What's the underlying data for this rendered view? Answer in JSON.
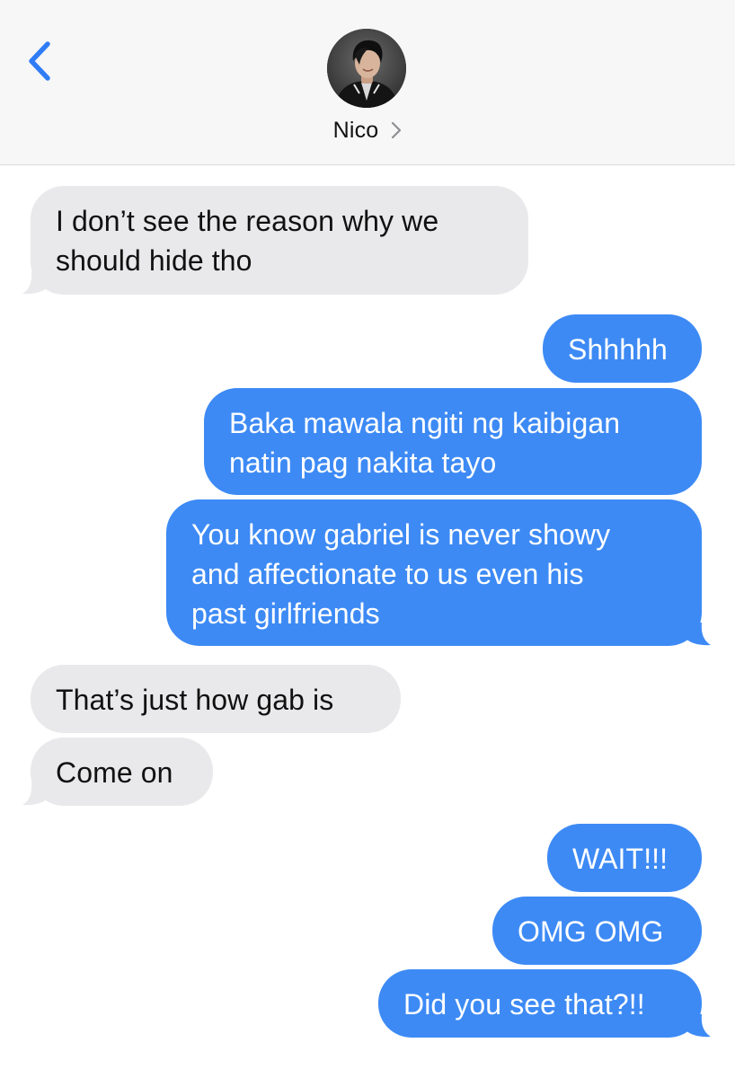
{
  "header": {
    "contact_name": "Nico",
    "back_icon": "chevron-left-icon",
    "details_icon": "chevron-right-icon",
    "avatar_icon": "contact-photo"
  },
  "colors": {
    "sent_bubble": "#3d8af5",
    "received_bubble": "#e9e9eb",
    "accent": "#2f7cf6"
  },
  "messages": [
    {
      "direction": "received",
      "lines": [
        "I don’t see the reason why we",
        "should hide tho"
      ]
    },
    {
      "direction": "sent",
      "lines": [
        "Shhhhh"
      ]
    },
    {
      "direction": "sent",
      "lines": [
        "Baka mawala ngiti ng kaibigan",
        "natin pag nakita tayo"
      ]
    },
    {
      "direction": "sent",
      "lines": [
        "You know gabriel is never showy",
        "and affectionate to us even his",
        "past girlfriends"
      ]
    },
    {
      "direction": "received",
      "lines": [
        "That’s just how gab is"
      ]
    },
    {
      "direction": "received",
      "lines": [
        "Come on"
      ]
    },
    {
      "direction": "sent",
      "lines": [
        "WAIT!!!"
      ]
    },
    {
      "direction": "sent",
      "lines": [
        "OMG OMG"
      ]
    },
    {
      "direction": "sent",
      "lines": [
        "Did you see that?!!"
      ]
    }
  ]
}
